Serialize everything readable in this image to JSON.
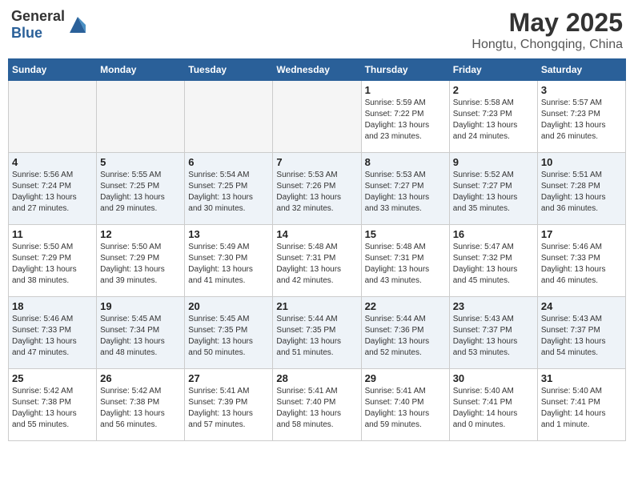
{
  "header": {
    "logo_general": "General",
    "logo_blue": "Blue",
    "month_year": "May 2025",
    "location": "Hongtu, Chongqing, China"
  },
  "weekdays": [
    "Sunday",
    "Monday",
    "Tuesday",
    "Wednesday",
    "Thursday",
    "Friday",
    "Saturday"
  ],
  "weeks": [
    [
      {
        "day": "",
        "detail": ""
      },
      {
        "day": "",
        "detail": ""
      },
      {
        "day": "",
        "detail": ""
      },
      {
        "day": "",
        "detail": ""
      },
      {
        "day": "1",
        "detail": "Sunrise: 5:59 AM\nSunset: 7:22 PM\nDaylight: 13 hours\nand 23 minutes."
      },
      {
        "day": "2",
        "detail": "Sunrise: 5:58 AM\nSunset: 7:23 PM\nDaylight: 13 hours\nand 24 minutes."
      },
      {
        "day": "3",
        "detail": "Sunrise: 5:57 AM\nSunset: 7:23 PM\nDaylight: 13 hours\nand 26 minutes."
      }
    ],
    [
      {
        "day": "4",
        "detail": "Sunrise: 5:56 AM\nSunset: 7:24 PM\nDaylight: 13 hours\nand 27 minutes."
      },
      {
        "day": "5",
        "detail": "Sunrise: 5:55 AM\nSunset: 7:25 PM\nDaylight: 13 hours\nand 29 minutes."
      },
      {
        "day": "6",
        "detail": "Sunrise: 5:54 AM\nSunset: 7:25 PM\nDaylight: 13 hours\nand 30 minutes."
      },
      {
        "day": "7",
        "detail": "Sunrise: 5:53 AM\nSunset: 7:26 PM\nDaylight: 13 hours\nand 32 minutes."
      },
      {
        "day": "8",
        "detail": "Sunrise: 5:53 AM\nSunset: 7:27 PM\nDaylight: 13 hours\nand 33 minutes."
      },
      {
        "day": "9",
        "detail": "Sunrise: 5:52 AM\nSunset: 7:27 PM\nDaylight: 13 hours\nand 35 minutes."
      },
      {
        "day": "10",
        "detail": "Sunrise: 5:51 AM\nSunset: 7:28 PM\nDaylight: 13 hours\nand 36 minutes."
      }
    ],
    [
      {
        "day": "11",
        "detail": "Sunrise: 5:50 AM\nSunset: 7:29 PM\nDaylight: 13 hours\nand 38 minutes."
      },
      {
        "day": "12",
        "detail": "Sunrise: 5:50 AM\nSunset: 7:29 PM\nDaylight: 13 hours\nand 39 minutes."
      },
      {
        "day": "13",
        "detail": "Sunrise: 5:49 AM\nSunset: 7:30 PM\nDaylight: 13 hours\nand 41 minutes."
      },
      {
        "day": "14",
        "detail": "Sunrise: 5:48 AM\nSunset: 7:31 PM\nDaylight: 13 hours\nand 42 minutes."
      },
      {
        "day": "15",
        "detail": "Sunrise: 5:48 AM\nSunset: 7:31 PM\nDaylight: 13 hours\nand 43 minutes."
      },
      {
        "day": "16",
        "detail": "Sunrise: 5:47 AM\nSunset: 7:32 PM\nDaylight: 13 hours\nand 45 minutes."
      },
      {
        "day": "17",
        "detail": "Sunrise: 5:46 AM\nSunset: 7:33 PM\nDaylight: 13 hours\nand 46 minutes."
      }
    ],
    [
      {
        "day": "18",
        "detail": "Sunrise: 5:46 AM\nSunset: 7:33 PM\nDaylight: 13 hours\nand 47 minutes."
      },
      {
        "day": "19",
        "detail": "Sunrise: 5:45 AM\nSunset: 7:34 PM\nDaylight: 13 hours\nand 48 minutes."
      },
      {
        "day": "20",
        "detail": "Sunrise: 5:45 AM\nSunset: 7:35 PM\nDaylight: 13 hours\nand 50 minutes."
      },
      {
        "day": "21",
        "detail": "Sunrise: 5:44 AM\nSunset: 7:35 PM\nDaylight: 13 hours\nand 51 minutes."
      },
      {
        "day": "22",
        "detail": "Sunrise: 5:44 AM\nSunset: 7:36 PM\nDaylight: 13 hours\nand 52 minutes."
      },
      {
        "day": "23",
        "detail": "Sunrise: 5:43 AM\nSunset: 7:37 PM\nDaylight: 13 hours\nand 53 minutes."
      },
      {
        "day": "24",
        "detail": "Sunrise: 5:43 AM\nSunset: 7:37 PM\nDaylight: 13 hours\nand 54 minutes."
      }
    ],
    [
      {
        "day": "25",
        "detail": "Sunrise: 5:42 AM\nSunset: 7:38 PM\nDaylight: 13 hours\nand 55 minutes."
      },
      {
        "day": "26",
        "detail": "Sunrise: 5:42 AM\nSunset: 7:38 PM\nDaylight: 13 hours\nand 56 minutes."
      },
      {
        "day": "27",
        "detail": "Sunrise: 5:41 AM\nSunset: 7:39 PM\nDaylight: 13 hours\nand 57 minutes."
      },
      {
        "day": "28",
        "detail": "Sunrise: 5:41 AM\nSunset: 7:40 PM\nDaylight: 13 hours\nand 58 minutes."
      },
      {
        "day": "29",
        "detail": "Sunrise: 5:41 AM\nSunset: 7:40 PM\nDaylight: 13 hours\nand 59 minutes."
      },
      {
        "day": "30",
        "detail": "Sunrise: 5:40 AM\nSunset: 7:41 PM\nDaylight: 14 hours\nand 0 minutes."
      },
      {
        "day": "31",
        "detail": "Sunrise: 5:40 AM\nSunset: 7:41 PM\nDaylight: 14 hours\nand 1 minute."
      }
    ]
  ]
}
